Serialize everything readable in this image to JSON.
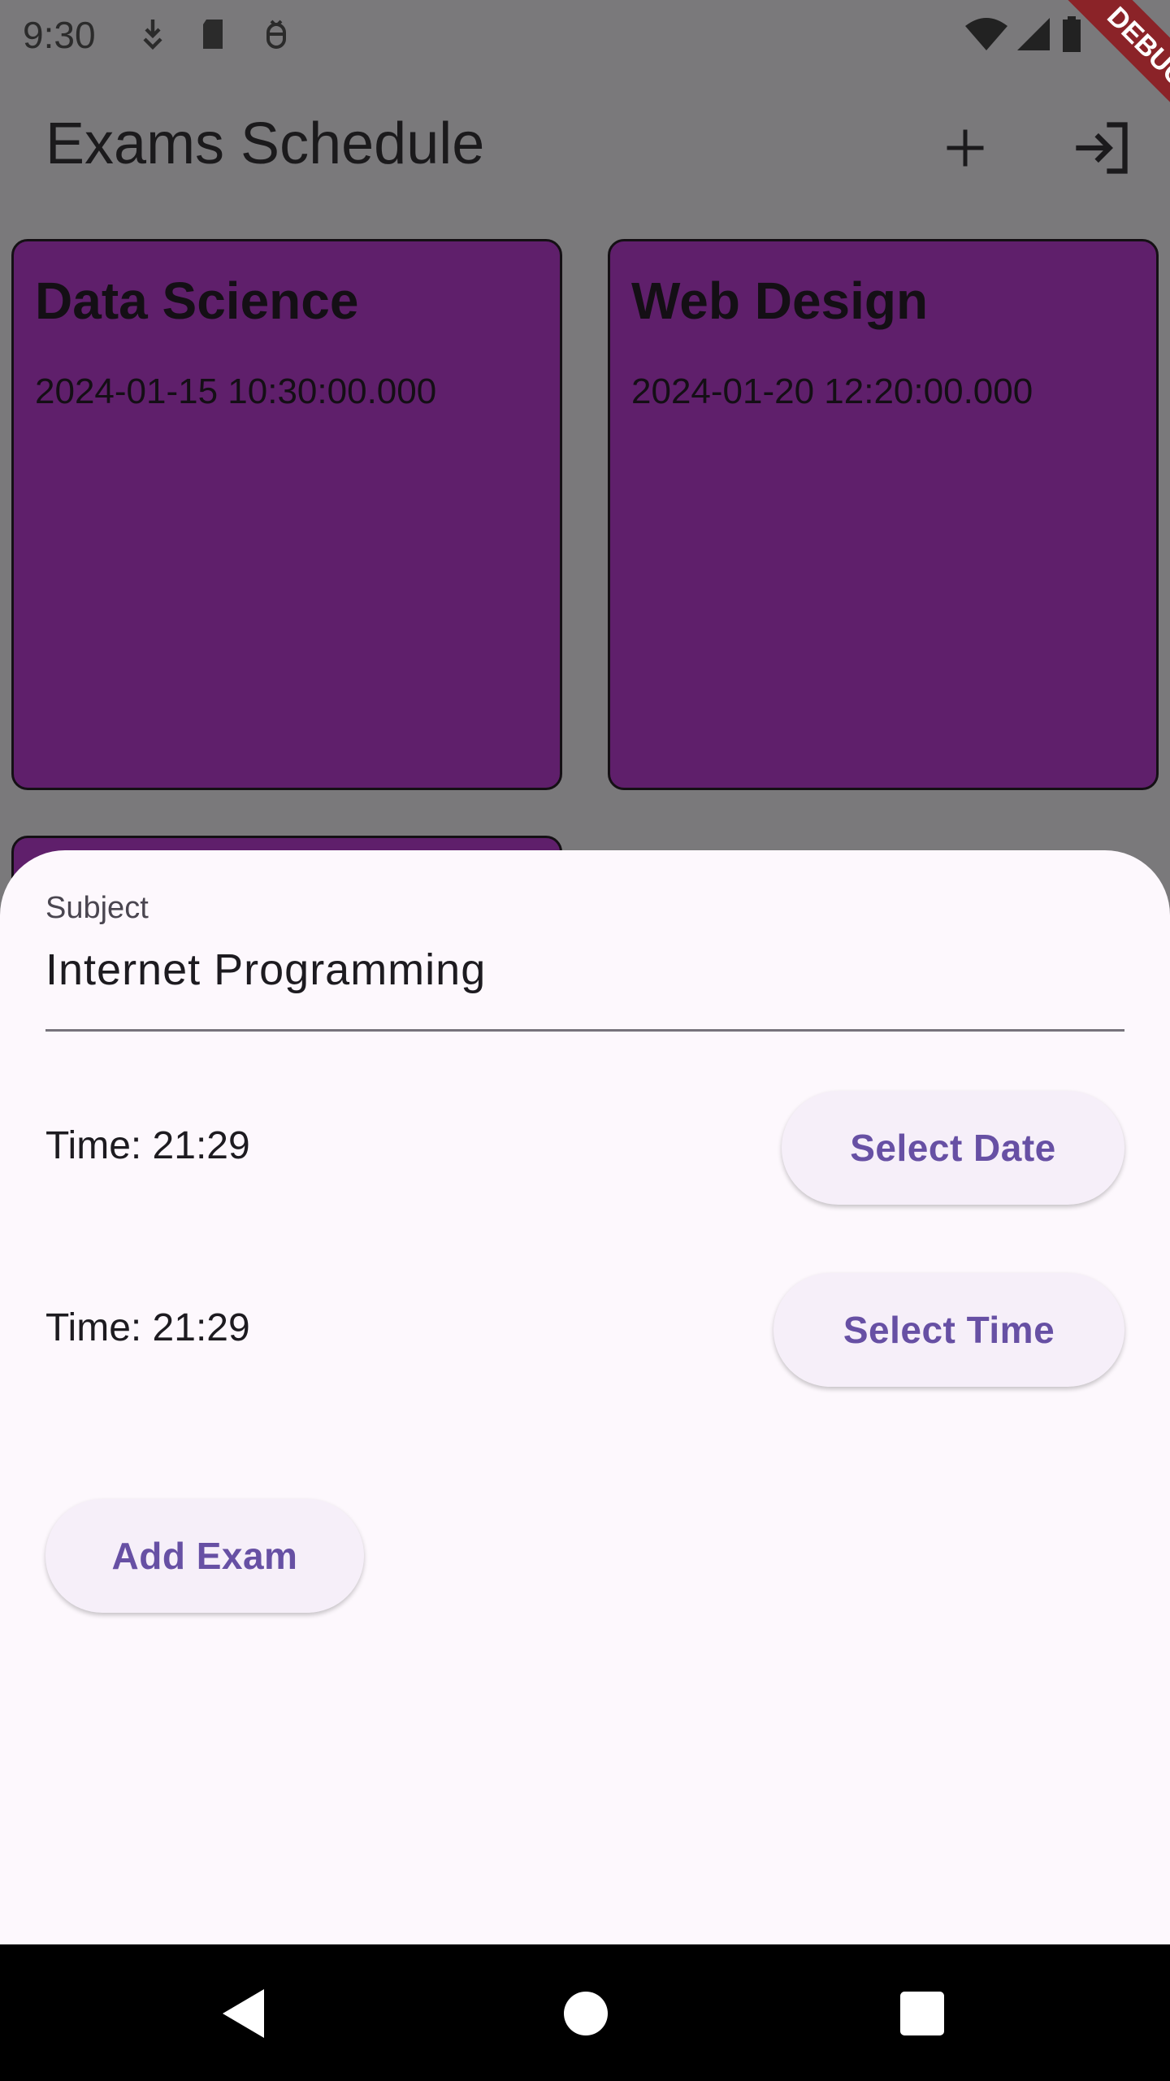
{
  "status_bar": {
    "time": "9:30",
    "icons": [
      "download-icon",
      "sd-card-icon",
      "bug-icon",
      "wifi-icon",
      "signal-icon",
      "battery-icon"
    ]
  },
  "debug_banner": "DEBUG",
  "app_bar": {
    "title": "Exams Schedule",
    "actions": [
      "add-icon",
      "login-icon"
    ]
  },
  "exams": [
    {
      "subject": "Data Science",
      "datetime": "2024-01-15 10:30:00.000"
    },
    {
      "subject": "Web Design",
      "datetime": "2024-01-20 12:20:00.000"
    }
  ],
  "form": {
    "subject_label": "Subject",
    "subject_value": "Internet Programming",
    "date_row_text": "Time: 21:29",
    "select_date_label": "Select Date",
    "time_row_text": "Time: 21:29",
    "select_time_label": "Select Time",
    "add_exam_label": "Add Exam"
  },
  "colors": {
    "card": "#5f1f6b",
    "accent": "#6750a4",
    "scrim": "#7a797b",
    "sheet": "#fdf8fd",
    "debug": "#8b2328"
  }
}
